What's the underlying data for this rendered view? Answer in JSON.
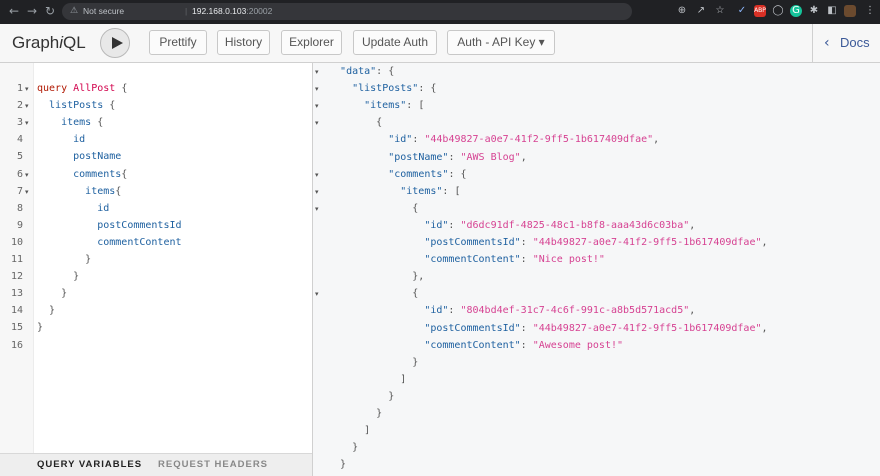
{
  "browser": {
    "back_icon": "back-arrow-icon",
    "forward_icon": "forward-arrow-icon",
    "reload_icon": "reload-icon",
    "security_label": "Not secure",
    "url_host": "192.168.0.103",
    "url_port": ":20002",
    "extension_icons": [
      "zoom-icon",
      "share-icon",
      "star-icon",
      "extension-icon",
      "adblock-icon",
      "shield-icon",
      "grammarly-icon",
      "puzzle-icon",
      "sidepanel-icon",
      "profile-icon",
      "menu-icon"
    ]
  },
  "toolbar": {
    "logo_pre": "Graph",
    "logo_i": "i",
    "logo_post": "QL",
    "buttons": [
      "Prettify",
      "History",
      "Explorer",
      "Update Auth",
      "Auth - API Key ▾"
    ],
    "docs_label": "Docs"
  },
  "editor": {
    "lines": [
      {
        "n": "1",
        "fold": true,
        "parts": [
          [
            "kw",
            "query"
          ],
          [
            "pn",
            " "
          ],
          [
            "def",
            "AllPost"
          ],
          [
            "pn",
            " {"
          ]
        ]
      },
      {
        "n": "2",
        "fold": true,
        "parts": [
          [
            "pn",
            "  "
          ],
          [
            "prop",
            "listPosts"
          ],
          [
            "pn",
            " {"
          ]
        ]
      },
      {
        "n": "3",
        "fold": true,
        "parts": [
          [
            "pn",
            "    "
          ],
          [
            "prop",
            "items"
          ],
          [
            "pn",
            " {"
          ]
        ]
      },
      {
        "n": "4",
        "fold": false,
        "parts": [
          [
            "pn",
            "      "
          ],
          [
            "prop",
            "id"
          ]
        ]
      },
      {
        "n": "5",
        "fold": false,
        "parts": [
          [
            "pn",
            "      "
          ],
          [
            "prop",
            "postName"
          ]
        ]
      },
      {
        "n": "6",
        "fold": true,
        "parts": [
          [
            "pn",
            "      "
          ],
          [
            "prop",
            "comments"
          ],
          [
            "pn",
            "{"
          ]
        ]
      },
      {
        "n": "7",
        "fold": true,
        "parts": [
          [
            "pn",
            "        "
          ],
          [
            "prop",
            "items"
          ],
          [
            "pn",
            "{"
          ]
        ]
      },
      {
        "n": "8",
        "fold": false,
        "parts": [
          [
            "pn",
            "          "
          ],
          [
            "prop",
            "id"
          ]
        ]
      },
      {
        "n": "9",
        "fold": false,
        "parts": [
          [
            "pn",
            "          "
          ],
          [
            "prop",
            "postCommentsId"
          ]
        ]
      },
      {
        "n": "10",
        "fold": false,
        "parts": [
          [
            "pn",
            "          "
          ],
          [
            "prop",
            "commentContent"
          ]
        ]
      },
      {
        "n": "11",
        "fold": false,
        "parts": [
          [
            "pn",
            "        }"
          ]
        ]
      },
      {
        "n": "12",
        "fold": false,
        "parts": [
          [
            "pn",
            "      }"
          ]
        ]
      },
      {
        "n": "13",
        "fold": false,
        "parts": [
          [
            "pn",
            "    }"
          ]
        ]
      },
      {
        "n": "14",
        "fold": false,
        "parts": [
          [
            "pn",
            "  }"
          ]
        ]
      },
      {
        "n": "15",
        "fold": false,
        "parts": [
          [
            "pn",
            "}"
          ]
        ]
      },
      {
        "n": "16",
        "fold": false,
        "parts": []
      }
    ],
    "tabs": [
      "QUERY VARIABLES",
      "REQUEST HEADERS"
    ]
  },
  "result": {
    "lines": [
      {
        "fold": true,
        "parts": [
          [
            "pn",
            "  "
          ],
          [
            "k",
            "\"data\""
          ],
          [
            "pn",
            ": {"
          ]
        ]
      },
      {
        "fold": true,
        "parts": [
          [
            "pn",
            "    "
          ],
          [
            "k",
            "\"listPosts\""
          ],
          [
            "pn",
            ": {"
          ]
        ]
      },
      {
        "fold": true,
        "parts": [
          [
            "pn",
            "      "
          ],
          [
            "k",
            "\"items\""
          ],
          [
            "pn",
            ": ["
          ]
        ]
      },
      {
        "fold": true,
        "parts": [
          [
            "pn",
            "        {"
          ]
        ]
      },
      {
        "fold": false,
        "parts": [
          [
            "pn",
            "          "
          ],
          [
            "k",
            "\"id\""
          ],
          [
            "pn",
            ": "
          ],
          [
            "s",
            "\"44b49827-a0e7-41f2-9ff5-1b617409dfae\""
          ],
          [
            "pn",
            ","
          ]
        ]
      },
      {
        "fold": false,
        "parts": [
          [
            "pn",
            "          "
          ],
          [
            "k",
            "\"postName\""
          ],
          [
            "pn",
            ": "
          ],
          [
            "s",
            "\"AWS Blog\""
          ],
          [
            "pn",
            ","
          ]
        ]
      },
      {
        "fold": true,
        "parts": [
          [
            "pn",
            "          "
          ],
          [
            "k",
            "\"comments\""
          ],
          [
            "pn",
            ": {"
          ]
        ]
      },
      {
        "fold": true,
        "parts": [
          [
            "pn",
            "            "
          ],
          [
            "k",
            "\"items\""
          ],
          [
            "pn",
            ": ["
          ]
        ]
      },
      {
        "fold": true,
        "parts": [
          [
            "pn",
            "              {"
          ]
        ]
      },
      {
        "fold": false,
        "parts": [
          [
            "pn",
            "                "
          ],
          [
            "k",
            "\"id\""
          ],
          [
            "pn",
            ": "
          ],
          [
            "s",
            "\"d6dc91df-4825-48c1-b8f8-aaa43d6c03ba\""
          ],
          [
            "pn",
            ","
          ]
        ]
      },
      {
        "fold": false,
        "parts": [
          [
            "pn",
            "                "
          ],
          [
            "k",
            "\"postCommentsId\""
          ],
          [
            "pn",
            ": "
          ],
          [
            "s",
            "\"44b49827-a0e7-41f2-9ff5-1b617409dfae\""
          ],
          [
            "pn",
            ","
          ]
        ]
      },
      {
        "fold": false,
        "parts": [
          [
            "pn",
            "                "
          ],
          [
            "k",
            "\"commentContent\""
          ],
          [
            "pn",
            ": "
          ],
          [
            "s",
            "\"Nice post!\""
          ]
        ]
      },
      {
        "fold": false,
        "parts": [
          [
            "pn",
            "              },"
          ]
        ]
      },
      {
        "fold": true,
        "parts": [
          [
            "pn",
            "              {"
          ]
        ]
      },
      {
        "fold": false,
        "parts": [
          [
            "pn",
            "                "
          ],
          [
            "k",
            "\"id\""
          ],
          [
            "pn",
            ": "
          ],
          [
            "s",
            "\"804bd4ef-31c7-4c6f-991c-a8b5d571acd5\""
          ],
          [
            "pn",
            ","
          ]
        ]
      },
      {
        "fold": false,
        "parts": [
          [
            "pn",
            "                "
          ],
          [
            "k",
            "\"postCommentsId\""
          ],
          [
            "pn",
            ": "
          ],
          [
            "s",
            "\"44b49827-a0e7-41f2-9ff5-1b617409dfae\""
          ],
          [
            "pn",
            ","
          ]
        ]
      },
      {
        "fold": false,
        "parts": [
          [
            "pn",
            "                "
          ],
          [
            "k",
            "\"commentContent\""
          ],
          [
            "pn",
            ": "
          ],
          [
            "s",
            "\"Awesome post!\""
          ]
        ]
      },
      {
        "fold": false,
        "parts": [
          [
            "pn",
            "              }"
          ]
        ]
      },
      {
        "fold": false,
        "parts": [
          [
            "pn",
            "            ]"
          ]
        ]
      },
      {
        "fold": false,
        "parts": [
          [
            "pn",
            "          }"
          ]
        ]
      },
      {
        "fold": false,
        "parts": [
          [
            "pn",
            "        }"
          ]
        ]
      },
      {
        "fold": false,
        "parts": [
          [
            "pn",
            "      ]"
          ]
        ]
      },
      {
        "fold": false,
        "parts": [
          [
            "pn",
            "    }"
          ]
        ]
      },
      {
        "fold": false,
        "parts": [
          [
            "pn",
            "  }"
          ]
        ]
      }
    ]
  },
  "colors": {
    "keyword": "#b11a04",
    "def": "#d2054e",
    "property": "#1f61a0",
    "string": "#d64292",
    "docs_link": "#3b5998",
    "active_tab": "#222222",
    "inactive_tab": "#888888"
  }
}
